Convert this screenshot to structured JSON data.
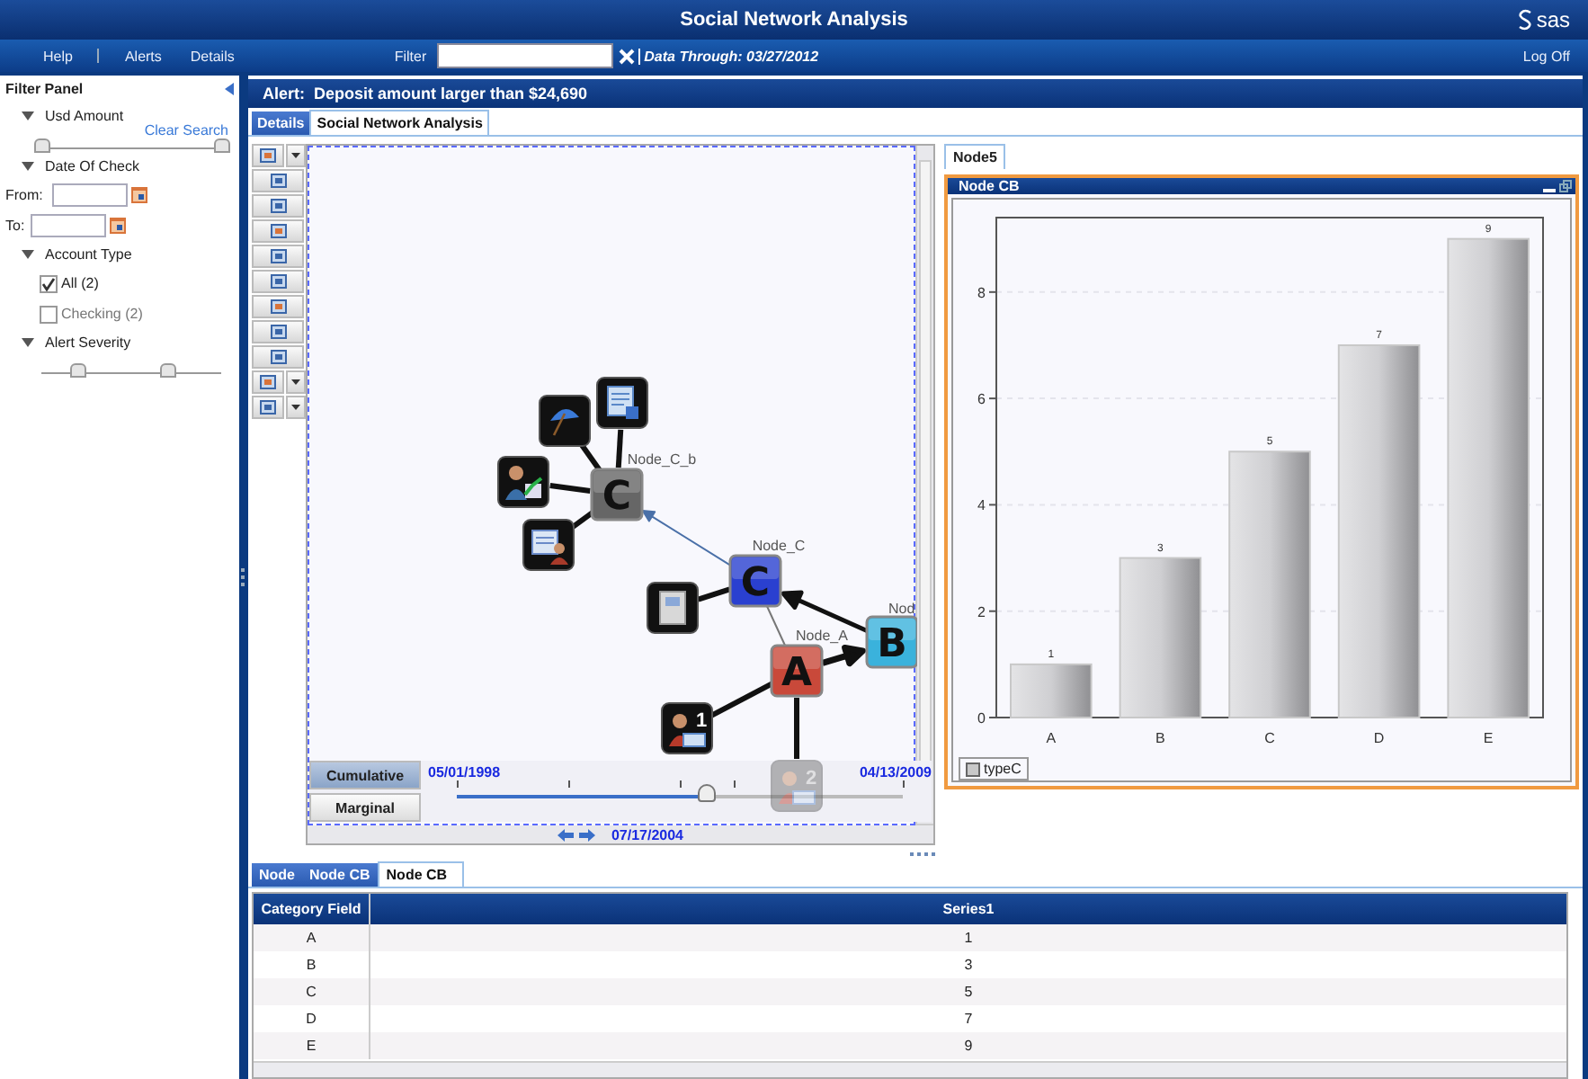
{
  "title_bar": {
    "title": "Social Network Analysis",
    "logo": "sas"
  },
  "menu_bar": {
    "items": [
      "Help",
      "Alerts",
      "Details"
    ],
    "filter": {
      "label": "Filter"
    },
    "data_through": "Data Through: 03/27/2012",
    "log_off": "Log Off"
  },
  "filter_panel": {
    "title": "Filter Panel",
    "sections": [
      {
        "kind": "range",
        "title": "Usd Amount",
        "expanded": true,
        "link": "Clear Search",
        "thumbs": [
          {
            "level": 0
          },
          {
            "level": 1
          }
        ]
      },
      {
        "kind": "dates",
        "title": "Date Of Check",
        "expanded": true,
        "fields": [
          {
            "label": "From:"
          },
          {
            "label": "To:"
          }
        ]
      },
      {
        "kind": "checks",
        "title": "Account Type",
        "expanded": true,
        "options": [
          {
            "label": "All (2)",
            "checked": true
          },
          {
            "label": "Checking (2)",
            "checked": false
          }
        ]
      },
      {
        "kind": "range",
        "title": "Alert Severity",
        "expanded": true,
        "thumbs": [
          {
            "level": 0.2
          },
          {
            "level": 0.7
          }
        ]
      }
    ]
  },
  "alert": "Alert:  Deposit amount larger than $24,690",
  "tabs": [
    {
      "label": "Details",
      "selected": false
    },
    {
      "label": "Social Network Analysis",
      "selected": true
    }
  ],
  "graph": {
    "toolbar": [
      {
        "dropdown": true
      },
      {
        "dropdown": false
      },
      {
        "dropdown": false
      },
      {
        "dropdown": false
      },
      {
        "dropdown": false
      },
      {
        "dropdown": false
      },
      {
        "dropdown": false
      },
      {
        "dropdown": false
      },
      {
        "dropdown": false
      },
      {
        "dropdown": true
      },
      {
        "dropdown": true
      }
    ],
    "nodes": [
      {
        "kind": "letter",
        "letter": "C",
        "label": "Node_C_b",
        "color": "#666666",
        "dimmed": false
      },
      {
        "kind": "letter",
        "letter": "C",
        "label": "Node_C",
        "color": "#2a40d0",
        "dimmed": false
      },
      {
        "kind": "letter",
        "letter": "A",
        "label": "Node_A",
        "color": "#c9493a",
        "dimmed": false
      },
      {
        "kind": "letter",
        "letter": "B",
        "label": "Nod",
        "color": "#3ab2dc",
        "dimmed": false
      },
      {
        "kind": "icon",
        "dimmed": false
      },
      {
        "kind": "icon",
        "dimmed": false
      },
      {
        "kind": "icon",
        "dimmed": false
      },
      {
        "kind": "icon",
        "dimmed": false
      },
      {
        "kind": "icon",
        "dimmed": false
      },
      {
        "kind": "icon",
        "badge": "1",
        "dimmed": false
      },
      {
        "kind": "icon",
        "badge": "2",
        "dimmed": true
      }
    ],
    "timeline": {
      "modes": [
        {
          "label": "Cumulative",
          "selected": true
        },
        {
          "label": "Marginal",
          "selected": false
        }
      ],
      "start": "05/01/1998",
      "end": "04/13/2009",
      "level": 0.56,
      "current": "07/17/2004"
    }
  },
  "side_panel": {
    "tabs": [
      {
        "label": "Node5",
        "selected": true
      }
    ],
    "window": {
      "title": "Node CB",
      "chart_data": {
        "type": "bar",
        "categories": [
          "A",
          "B",
          "C",
          "D",
          "E"
        ],
        "series": [
          {
            "name": "typeC",
            "color": "#c8c8c8",
            "values": [
              1,
              3,
              5,
              7,
              9
            ]
          }
        ],
        "ylim": [
          0,
          9.4
        ],
        "yticks": [
          0,
          2,
          4,
          6,
          8
        ],
        "grid": true,
        "data_labels": true
      }
    }
  },
  "bottom_tabs": [
    {
      "label": "Node",
      "selected": false
    },
    {
      "label": "Node CB",
      "selected": false
    },
    {
      "label": "Node CB",
      "selected": true
    }
  ],
  "table": {
    "columns": [
      "Category Field",
      "Series1"
    ],
    "rows": [
      [
        "A",
        "1"
      ],
      [
        "B",
        "3"
      ],
      [
        "C",
        "5"
      ],
      [
        "D",
        "7"
      ],
      [
        "E",
        "9"
      ]
    ]
  }
}
